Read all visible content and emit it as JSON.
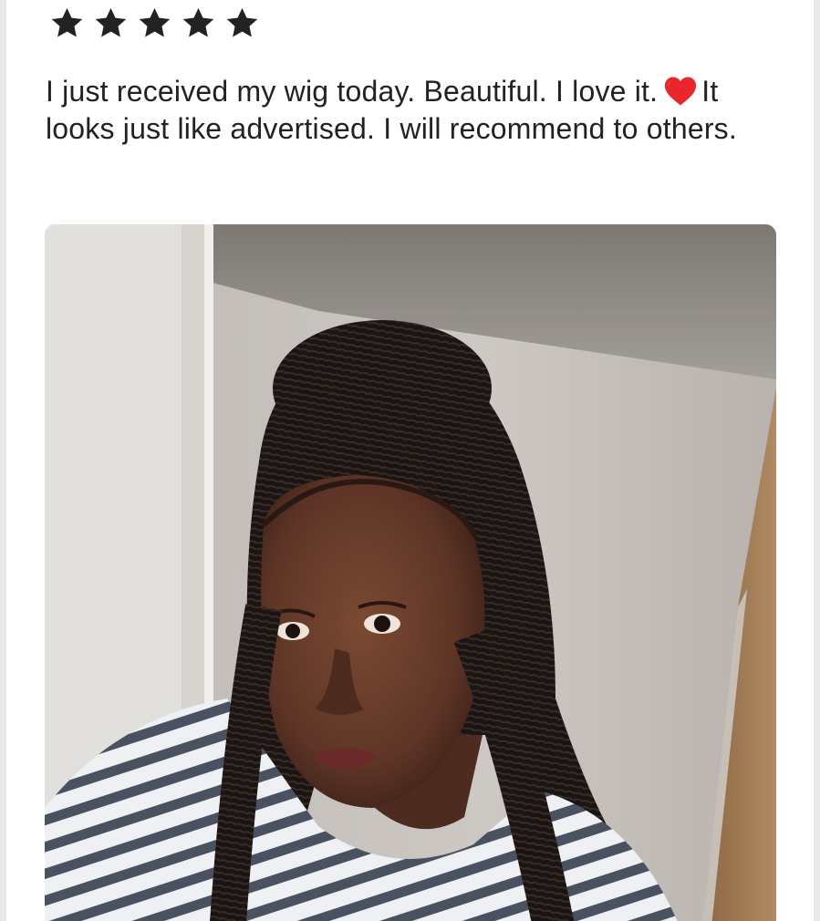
{
  "review": {
    "rating": 5,
    "rating_max": 5,
    "star_icon": "star-icon",
    "text_part1": "I just received my wig today.  Beautiful.  I love it.",
    "heart_icon": "red-heart-icon",
    "text_part2": "It looks just like advertised.  I will recommend to others.",
    "colors": {
      "star": "#222222",
      "text": "#222222",
      "heart": "#e8262c"
    }
  },
  "photo": {
    "type": "customer-review-photo",
    "subject": "selfie of reviewer wearing braided wig"
  }
}
